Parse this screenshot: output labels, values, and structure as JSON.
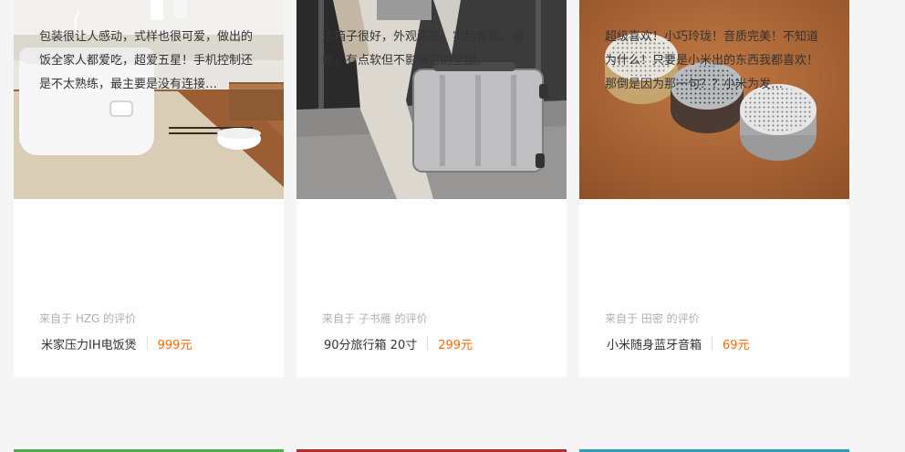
{
  "cards": [
    {
      "image": "rice-cooker-photo",
      "review": "包装很让人感动，式样也很可爱，做出的饭全家人都爱吃，超爱五星！手机控制还是不太熟练，最主要是没有连接…",
      "source": "来自于 HZG 的评价",
      "product": "米家压力IH电饭煲",
      "price": "999元"
    },
    {
      "image": "suitcase-photo",
      "review": "这箱子很好，外观漂亮，实用性强。很轻，有点软但不影响它的坚固。",
      "source": "来自于 子书雁 的评价",
      "product": "90分旅行箱 20寸",
      "price": "299元"
    },
    {
      "image": "speakers-photo",
      "review": "超级喜欢！小巧玲珑！音质完美！不知道为什么！只要是小米出的东西我都喜欢！那倒是因为那一句？？小米为发…",
      "source": "来自于 田密 的评价",
      "product": "小米随身蓝牙音箱",
      "price": "69元"
    }
  ],
  "colors": {
    "price": "#ff6700",
    "strip_1": "#4caf50",
    "strip_2": "#b03030",
    "strip_3": "#2a9fb0"
  }
}
